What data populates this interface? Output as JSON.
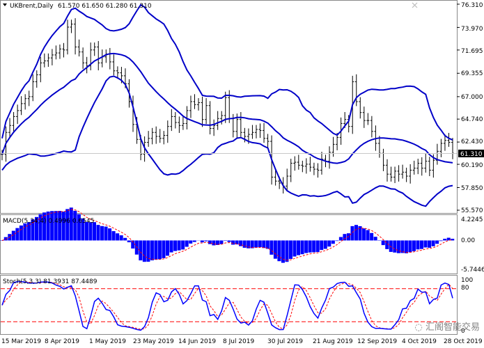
{
  "header": {
    "symbol_timeframe": "UKBrent,Daily",
    "ohlc": "61.570 61.650 61.280 61.310"
  },
  "main_pane": {
    "price_axis_labels": [
      "76.310",
      "73.970",
      "71.695",
      "69.355",
      "67.000",
      "64.740",
      "62.430",
      "60.190",
      "57.850",
      "55.570"
    ],
    "current_price_tag": "61.310"
  },
  "macd_pane": {
    "label": "MACD(5,34,4) 0.4996 0.6545",
    "axis_labels": [
      "4.2245",
      "0.00",
      "-5.7446"
    ]
  },
  "stoch_pane": {
    "label": "Stoch(5,3,3) 81.3931 87.4489",
    "axis_labels": [
      "100",
      "80",
      "0"
    ]
  },
  "time_axis": {
    "labels": [
      "15 Mar 2019",
      "8 Apr 2019",
      "1 May 2019",
      "23 May 2019",
      "14 Jun 2019",
      "8 Jul 2019",
      "30 Jul 2019",
      "21 Aug 2019",
      "12 Sep 2019",
      "4 Oct 2019",
      "28 Oct 2019"
    ]
  },
  "watermark": "汇阁智能交易",
  "colors": {
    "bars": "#000000",
    "bollinger": "#0000c8",
    "macd_hist": "#0000ff",
    "signal": "#ff0000",
    "grid": "#c8c8c8",
    "price_tag_bg": "#000000"
  },
  "chart_data": {
    "type": "line",
    "price_closes": [
      61.2,
      63.4,
      64.1,
      65.0,
      65.6,
      66.3,
      66.8,
      67.0,
      68.5,
      69.2,
      70.4,
      70.6,
      70.9,
      71.2,
      71.4,
      71.8,
      71.7,
      74.0,
      74.3,
      72.0,
      71.5,
      70.4,
      70.1,
      71.7,
      72.0,
      70.4,
      71.0,
      71.3,
      70.5,
      69.6,
      69.4,
      69.1,
      68.3,
      66.5,
      64.2,
      62.7,
      61.2,
      62.4,
      62.8,
      63.4,
      63.0,
      62.8,
      63.1,
      64.0,
      65.0,
      64.4,
      64.1,
      64.3,
      65.6,
      66.5,
      66.2,
      66.4,
      64.7,
      66.1,
      63.8,
      64.1,
      64.8,
      65.1,
      66.9,
      64.8,
      63.5,
      64.7,
      63.4,
      63.0,
      63.2,
      63.4,
      63.7,
      63.6,
      62.8,
      62.5,
      58.9,
      58.5,
      58.3,
      58.0,
      59.0,
      60.3,
      60.4,
      60.1,
      60.0,
      60.2,
      59.9,
      59.7,
      59.6,
      60.7,
      60.5,
      61.4,
      62.2,
      62.9,
      64.3,
      64.7,
      64.0,
      68.5,
      66.5,
      65.4,
      64.6,
      64.6,
      63.5,
      62.3,
      61.3,
      60.1,
      59.2,
      58.9,
      59.5,
      59.2,
      59.4,
      59.0,
      59.6,
      59.8,
      60.3,
      59.8,
      60.5,
      59.6,
      60.6,
      61.5,
      62.3,
      62.6,
      62.4,
      61.3
    ],
    "price_axis_range": [
      55.57,
      76.31
    ],
    "macd_axis_range": [
      -5.7446,
      4.2245
    ],
    "stoch_levels": [
      80,
      20
    ],
    "series": [
      {
        "name": "MACD",
        "last": 0.4996
      },
      {
        "name": "Signal",
        "last": 0.6545
      },
      {
        "name": "%K",
        "last": 81.3931
      },
      {
        "name": "%D",
        "last": 87.4489
      }
    ]
  }
}
